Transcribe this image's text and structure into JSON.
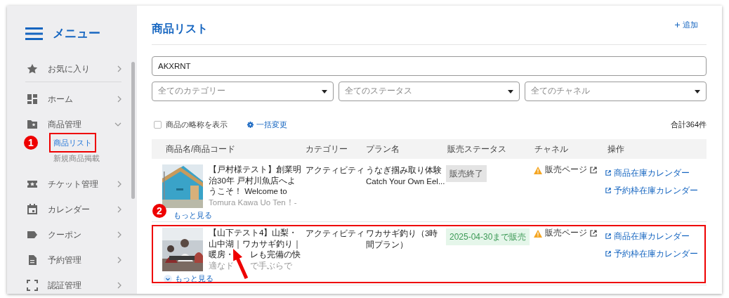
{
  "sidebar": {
    "title": "メニュー",
    "items": [
      {
        "label": "お気に入り",
        "expanded": false
      },
      {
        "label": "ホーム",
        "expanded": false
      },
      {
        "label": "商品管理",
        "expanded": true,
        "children": [
          {
            "label": "商品リスト",
            "selected": true,
            "highlighted": true,
            "callout": "1"
          },
          {
            "label": "新規商品掲載",
            "selected": false
          }
        ]
      },
      {
        "label": "チケット管理",
        "expanded": false
      },
      {
        "label": "カレンダー",
        "expanded": false
      },
      {
        "label": "クーポン",
        "expanded": false
      },
      {
        "label": "予約管理",
        "expanded": false
      },
      {
        "label": "認証管理",
        "expanded": false
      }
    ]
  },
  "page": {
    "title": "商品リスト",
    "add_button": "追加"
  },
  "search": {
    "value": "AKXRNT"
  },
  "filters": [
    {
      "placeholder": "全てのカテゴリー"
    },
    {
      "placeholder": "全てのステータス"
    },
    {
      "placeholder": "全てのチャネル"
    }
  ],
  "options": {
    "checkbox": {
      "label": "商品の略称を表示",
      "checked": false
    },
    "bulk_edit": "一括変更",
    "total": "合計364件"
  },
  "table": {
    "columns": [
      "商品名/商品コード",
      "カテゴリー",
      "プラン名",
      "販売ステータス",
      "チャネル",
      "操作"
    ],
    "rows": [
      {
        "name": [
          [
            "【戸村様テスト】創業明"
          ],
          [
            "治30年 戸村川魚店へよ"
          ],
          [
            "うこそ！ Welcome to"
          ],
          [
            "Tomura Kawa Uo Ten！-"
          ]
        ],
        "category": "アクティビティ",
        "plan": [
          "うなぎ掴み取り体験",
          "Catch Your Own Eel..."
        ],
        "status": {
          "text": "販売終了",
          "kind": "ended"
        },
        "channel": "販売ページ",
        "actions": [
          "商品在庫カレンダー",
          "予約枠在庫カレンダー"
        ],
        "more": "もっと見る",
        "callout": "2"
      },
      {
        "name": [
          [
            "【山下テスト4】山梨・"
          ],
          [
            "山中湖｜ワカサギ釣り｜"
          ],
          [
            "暖房・",
            "レも完備の快"
          ],
          [
            "適なド",
            "で手ぶらで"
          ]
        ],
        "category": "アクティビティ",
        "plan": [
          "ワカサギ釣り（3時",
          "間プラン）"
        ],
        "status": {
          "text": "2025-04-30まで販売",
          "kind": "active"
        },
        "channel": "販売ページ",
        "actions": [
          "商品在庫カレンダー",
          "予約枠在庫カレンダー"
        ],
        "more": "もっと見る",
        "more_icon": true,
        "highlighted": true,
        "arrow": true
      }
    ]
  }
}
